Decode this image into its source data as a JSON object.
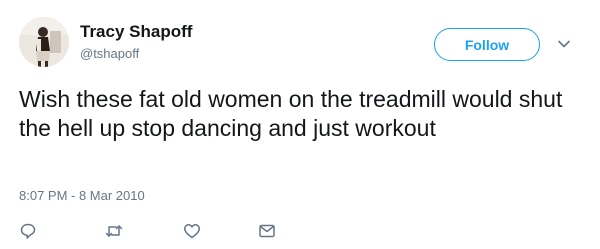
{
  "user": {
    "display_name": "Tracy Shapoff",
    "handle": "@tshapoff",
    "avatar_icon": "profile-photo"
  },
  "follow_label": "Follow",
  "more_icon": "chevron-down-icon",
  "tweet": {
    "text": "Wish these fat old women on the treadmill would shut the hell up stop dancing and just workout",
    "timestamp": "8:07 PM - 8 Mar 2010"
  },
  "actions": [
    "reply-icon",
    "retweet-icon",
    "like-icon",
    "direct-message-icon"
  ],
  "colors": {
    "accent": "#1da1f2",
    "secondary_text": "#657786",
    "icon": "#657786",
    "primary_text": "#14171a"
  }
}
